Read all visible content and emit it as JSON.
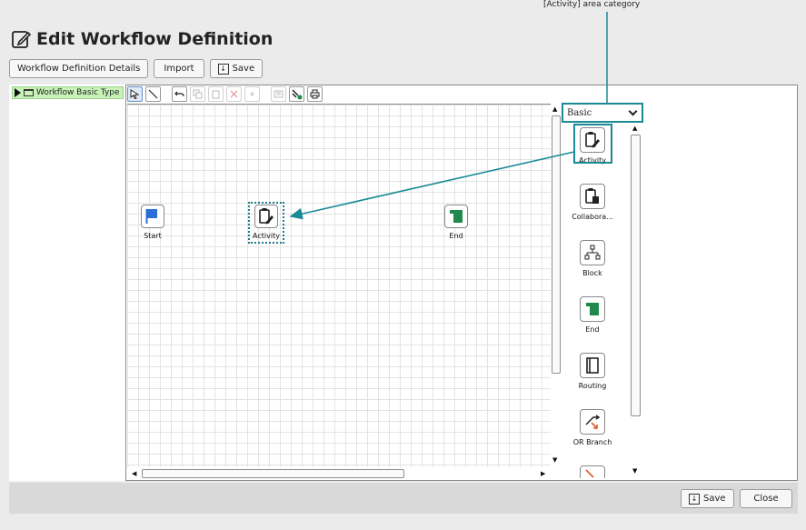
{
  "annotation": {
    "label": "[Activity] area category"
  },
  "header": {
    "title": "Edit Workflow Definition"
  },
  "top_toolbar": {
    "details_label": "Workflow Definition Details",
    "import_label": "Import",
    "save_label": "Save"
  },
  "tree": {
    "node_label": "Workflow Basic Type"
  },
  "canvas_nodes": {
    "start": "Start",
    "activity": "Activity",
    "end": "End"
  },
  "palette": {
    "category": "Basic",
    "items": [
      "Activity",
      "Collabora...",
      "Block",
      "End",
      "Routing",
      "OR Branch"
    ]
  },
  "bottom": {
    "save_label": "Save",
    "close_label": "Close"
  },
  "colors": {
    "accent": "#1a8a96",
    "start_flag": "#2b6fd6",
    "end_green": "#1f8a4c",
    "tree_node_bg": "#c8f2b8"
  }
}
